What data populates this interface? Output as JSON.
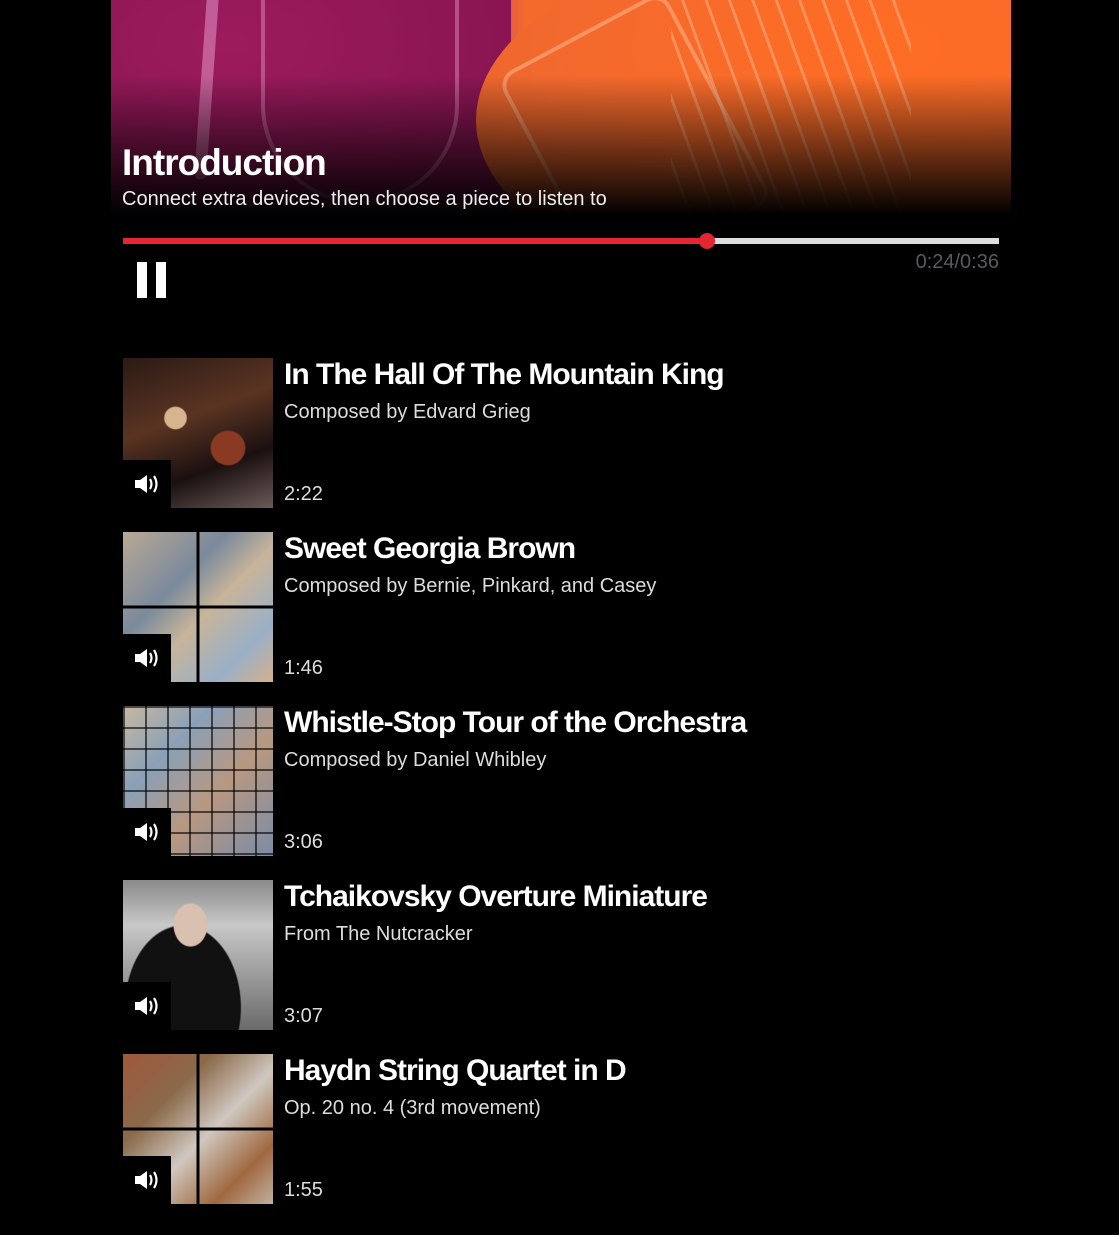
{
  "header": {
    "title": "Introduction",
    "subtitle": "Connect extra devices, then choose a piece to listen to"
  },
  "player": {
    "current_time": "0:24",
    "total_time": "0:36",
    "time_label": "0:24/0:36",
    "progress_fraction": 0.667,
    "state": "playing",
    "pause_icon": "pause-icon",
    "accent_color": "#e3262f",
    "track_color": "#dddddd"
  },
  "pieces": [
    {
      "title": "In The Hall Of The Mountain King",
      "subtitle": "Composed by Edvard Grieg",
      "duration": "2:22",
      "icon": "volume-icon"
    },
    {
      "title": "Sweet Georgia Brown",
      "subtitle": "Composed by Bernie, Pinkard, and Casey",
      "duration": "1:46",
      "icon": "volume-icon"
    },
    {
      "title": "Whistle-Stop Tour of the Orchestra",
      "subtitle": "Composed by Daniel Whibley",
      "duration": "3:06",
      "icon": "volume-icon"
    },
    {
      "title": "Tchaikovsky Overture Miniature",
      "subtitle": "From The Nutcracker",
      "duration": "3:07",
      "icon": "volume-icon"
    },
    {
      "title": "Haydn String Quartet in D",
      "subtitle": "Op. 20 no. 4 (3rd movement)",
      "duration": "1:55",
      "icon": "volume-icon"
    }
  ]
}
